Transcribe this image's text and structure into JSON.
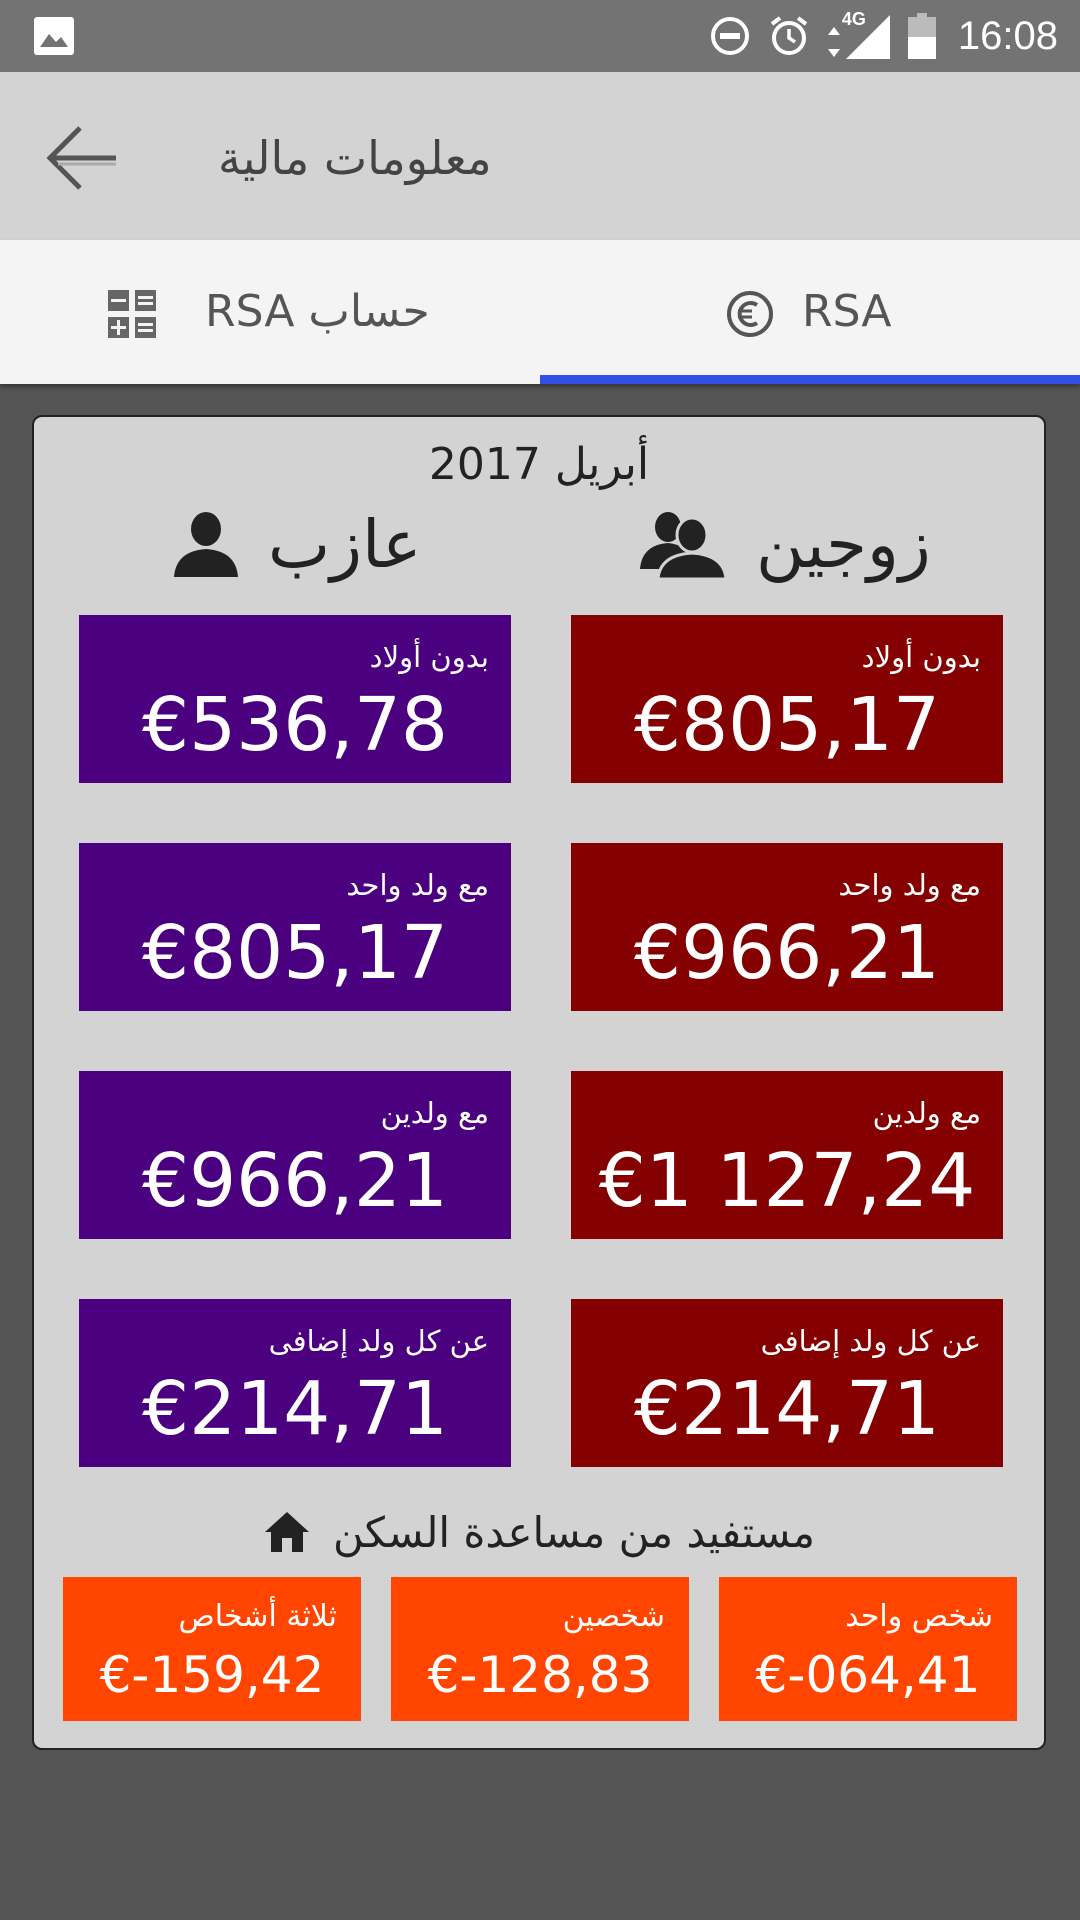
{
  "status_bar": {
    "time": "16:08",
    "network": "4G",
    "icons": [
      "gallery-icon",
      "do-not-disturb-icon",
      "alarm-icon",
      "data-arrows-icon",
      "signal-icon",
      "battery-icon"
    ]
  },
  "app_bar": {
    "title": "معلومات مالية",
    "back_icon": "arrow-back-icon"
  },
  "tabs": [
    {
      "label": "حساب  RSA",
      "icon": "calculator-icon",
      "selected": false
    },
    {
      "label": "RSA",
      "icon": "euro-icon",
      "selected": true
    }
  ],
  "accent_color": "#3350e6",
  "card": {
    "date": "أبريل 2017",
    "single": {
      "heading": "عازب",
      "icon": "person-icon",
      "color": "#4a007f",
      "items": [
        {
          "label": "بدون أولاد",
          "value": "€536,78"
        },
        {
          "label": "مع ولد واحد",
          "value": "€805,17"
        },
        {
          "label": "مع ولدين",
          "value": "€966,21"
        },
        {
          "label": "عن كل ولد إضافى",
          "value": "€214,71"
        }
      ]
    },
    "couple": {
      "heading": "زوجين",
      "icon": "people-icon",
      "color": "#850000",
      "items": [
        {
          "label": "بدون أولاد",
          "value": "€805,17"
        },
        {
          "label": "مع ولد واحد",
          "value": "€966,21"
        },
        {
          "label": "مع ولدين",
          "value": "€1 127,24"
        },
        {
          "label": "عن كل ولد إضافى",
          "value": "€214,71"
        }
      ]
    },
    "housing": {
      "heading": "مستفيد من مساعدة السكن",
      "icon": "home-icon",
      "color": "#ff4500",
      "items": [
        {
          "label": "ثلاثة أشخاص",
          "value": "€-159,42"
        },
        {
          "label": "شخصين",
          "value": "€-128,83"
        },
        {
          "label": "شخص واحد",
          "value": "€-064,41"
        }
      ]
    }
  }
}
